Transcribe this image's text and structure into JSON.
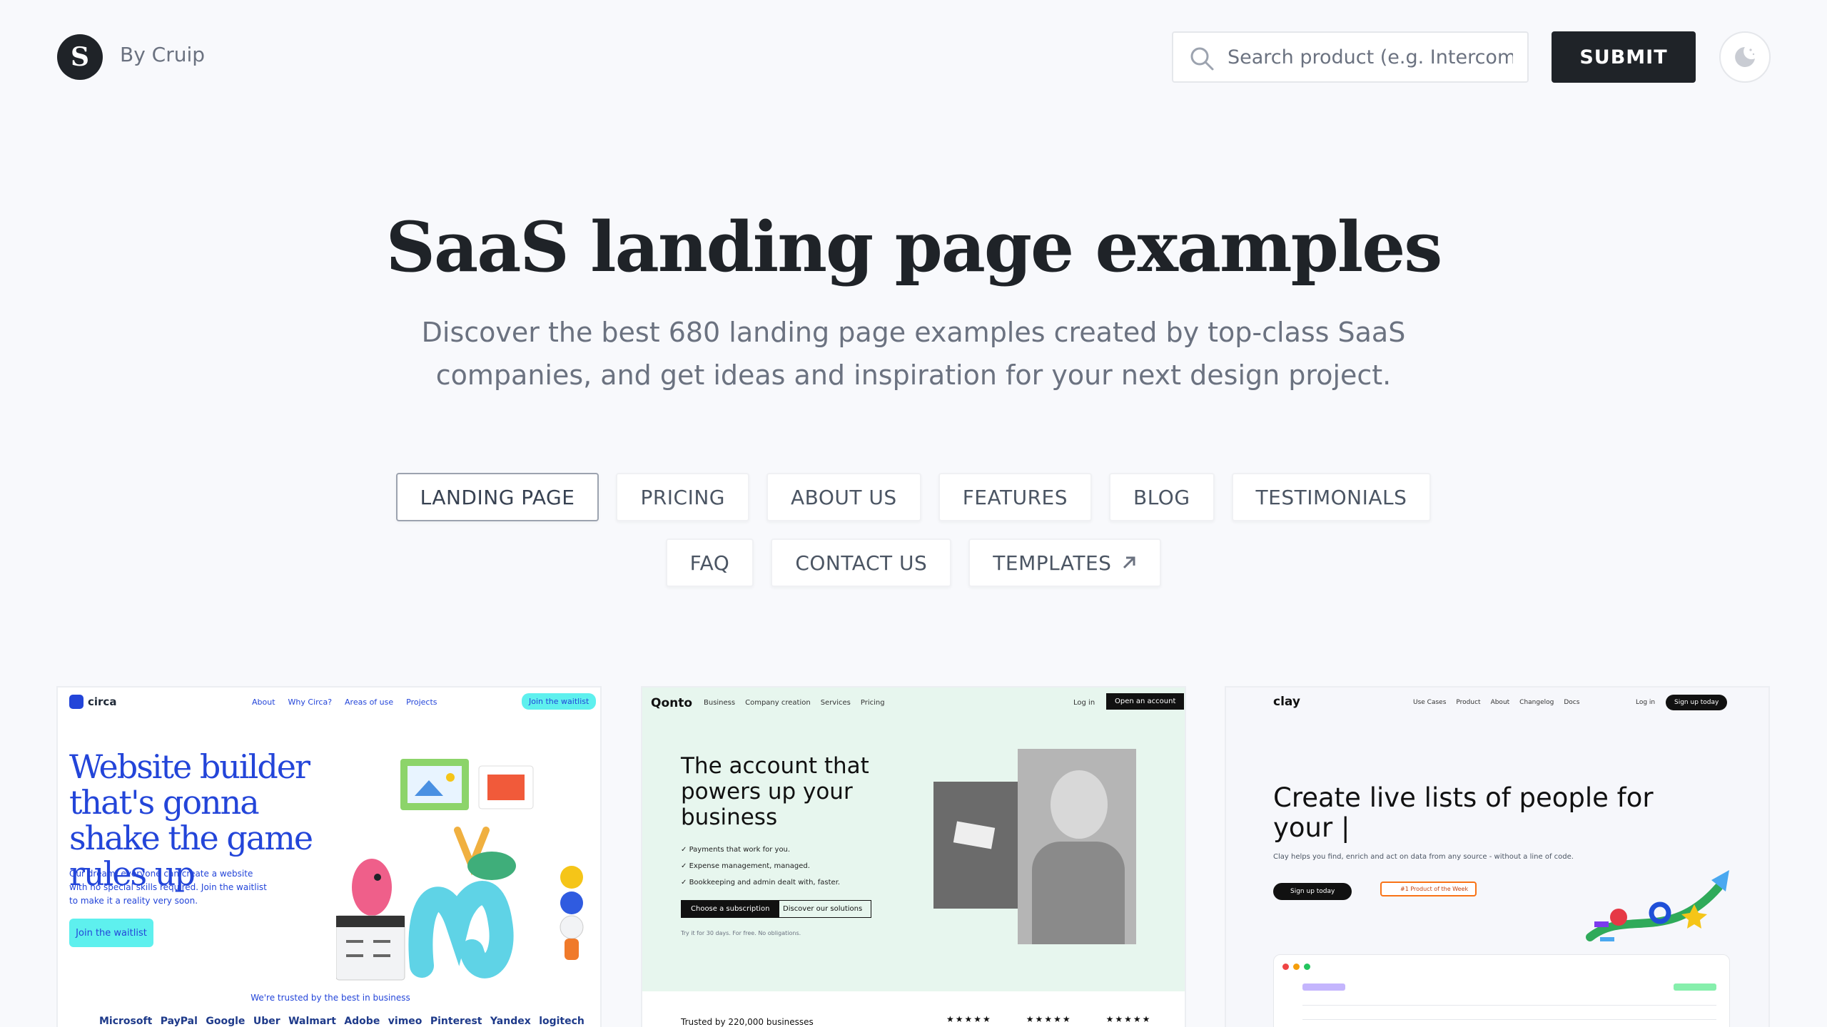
{
  "header": {
    "logo_letter": "S",
    "byline": "By Cruip",
    "search_placeholder": "Search product (e.g. Intercom)",
    "submit_label": "SUBMIT"
  },
  "hero": {
    "title": "SaaS landing page examples",
    "subtitle": "Discover the best 680 landing page examples created by top-class SaaS companies, and get ideas and inspiration for your next design project."
  },
  "categories": {
    "row1": [
      "LANDING PAGE",
      "PRICING",
      "ABOUT US",
      "FEATURES",
      "BLOG",
      "TESTIMONIALS"
    ],
    "row2": [
      "FAQ",
      "CONTACT US",
      "TEMPLATES"
    ],
    "active": "LANDING PAGE"
  },
  "cards": [
    {
      "brand": "circa",
      "nav": [
        "About",
        "Why Circa?",
        "Areas of use",
        "Projects"
      ],
      "cta": "Join the waitlist",
      "headline": "Website builder that's gonna shake the game rules up",
      "body": "Our dream: everyone can create a website with no special skills required. Join the waitlist to make it a reality very soon.",
      "button": "Join the waitlist",
      "trust": "We're trusted by the best in business",
      "logos": [
        "Microsoft",
        "PayPal",
        "Google",
        "Uber",
        "Walmart",
        "Adobe",
        "vimeo",
        "Pinterest",
        "Yandex",
        "logitech"
      ]
    },
    {
      "brand": "Qonto",
      "nav": [
        "Business",
        "Company creation",
        "Services",
        "Pricing"
      ],
      "login": "Log in",
      "cta": "Open an account",
      "headline": "The account that powers up your business",
      "bullets": [
        "Payments that work for you.",
        "Expense management, managed.",
        "Bookkeeping and admin dealt with, faster."
      ],
      "button_primary": "Choose a subscription",
      "button_secondary": "Discover our solutions",
      "fine_print": "Try it for 30 days. For free. No obligations.",
      "trust": "Trusted by 220,000 businesses",
      "stars": [
        "★★★★★",
        "★★★★★",
        "★★★★★"
      ]
    },
    {
      "brand": "clay",
      "nav": [
        "Use Cases",
        "Product",
        "About",
        "Changelog",
        "Docs"
      ],
      "login": "Log in",
      "cta": "Sign up today",
      "headline": "Create live lists of people for your |",
      "body": "Clay helps you find, enrich and act on data from any source - without a line of code.",
      "button_primary": "Sign up today",
      "badge": "#1 Product of the Week"
    }
  ],
  "colors": {
    "background": "#f8f9fc",
    "dark": "#1f2328",
    "muted": "#6b7280",
    "circa_blue": "#2345d9",
    "circa_cyan": "#5ef0ee",
    "qonto_bg": "#e7f6ee"
  }
}
